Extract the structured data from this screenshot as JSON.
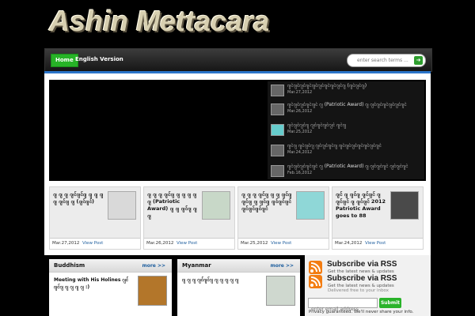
{
  "site": {
    "title": "Ashin Mettacara"
  },
  "nav": {
    "home": "Home",
    "english": "English Version",
    "search_placeholder": "enter search terms ..."
  },
  "featured": {
    "items": [
      {
        "title": "ဂျင်ဂျင်ဂျင်ဂျင်ဂျင်ဂျင်ဂျင်ဂျင်ဂျင်ဂျ (ဂျင်ဂျင်ဂျ)",
        "date": "Mar.27,2012"
      },
      {
        "title": "ဂျင်ဂျင်ဂျင်ဂျင်ဂျင် ဂျ (Patriotic Award) ဂျ ဂျင်ဂျင်ဂျင်ဂျင်ဂျင်ဂျင်",
        "date": "Mar.26,2012"
      },
      {
        "title": "ဂျင်ဂျင်ဂျင်ဂျ ဂျင်ဂျင်ဂျင်ဂျင် ဂျင်ဂျ",
        "date": "Mar.25,2012"
      },
      {
        "title": "ဂျင်ဂျ ဂျင်ဂျင်ဂျ ဂျင်ဂျင်ဂျင်ဂျ ဂျင်ဂျင်ဂျင်ဂျင်ဂျင်ဂျင်ဂျင်",
        "date": "Mar.24,2012"
      },
      {
        "title": "ဂျင်ဂျင်ဂျင်ဂျင်ဂျင် ဂျ (Patriotic Award) ဂျ ဂျင်ဂျင်ဂျင် ဂျင်ဂျင်ဂျင်",
        "date": "Feb.16,2012"
      }
    ]
  },
  "cards": [
    {
      "text": "ဂျ ဂျ ဂျ ဂျင်ဂျင်ဂျ ဂျ ဂျ ဂျ ဂျ ဂျင်ဂျ ဂျ (ဂျင်ဂျင်)",
      "date": "Mar.27,2012",
      "link": "View Post"
    },
    {
      "text": "ဂျ ဂျ ဂျ ဂျင်ဂျ ဂျ ဂျ ဂျ ဂျ ဂျ (Patriotic Award) ဂျ ဂျ ဂျင်ဂျ ဂျ ဂျ",
      "date": "Mar.26,2012",
      "link": "View Post"
    },
    {
      "text": "ဂျ ဂျ ဂျ ဂျင်ဂျ ဂျ ဂျ ဂျင်ဂျ ဂျင်ဂျ ဂျ ဂျင်ဂျ ဂျင်ဂျင်ဂျင် ဂျင်ဂျင်ဂျင်ဂျင်",
      "date": "Mar.25,2012",
      "link": "View Post"
    },
    {
      "text": "ဂျင် ဂျ ဂျင်ဂျ ဂျင်ဂျင် ဂျ ဂျင်ဂျင် ဂျ ဂျင်ဂျင် 2012 Patriotic Award goes to 88",
      "date": "Mar.24,2012",
      "link": "View Post"
    }
  ],
  "panels": [
    {
      "title": "Buddhism",
      "more": "more >>",
      "text": "Meeting with His Holines ဂျင်ဂျင်ဂျ ဂျ ဂျ ဂျ ဂျ :)"
    },
    {
      "title": "Myanmar",
      "more": "more >>",
      "text": "ဂျ ဂျ ဂျ ဂျင်ဂျင်ဂျ ဂျ ဂျ ဂျ ဂျ ဂျ"
    }
  ],
  "subscribe": {
    "rss1_title": "Subscribe via RSS",
    "rss1_sub": "Get the latest news & updates",
    "rss2_title": "Subscribe via RSS",
    "rss2_sub": "Get the latest news & updates",
    "rss2_sub2": "Delivered free to your inbox",
    "email_placeholder": "enter email address",
    "submit": "Submit",
    "privacy": "Privacy guaranteed. We'll never share your info."
  },
  "colors": {
    "accent_green": "#27b327",
    "nav_blue": "#2a74c9",
    "rss_orange": "#f37d12"
  }
}
